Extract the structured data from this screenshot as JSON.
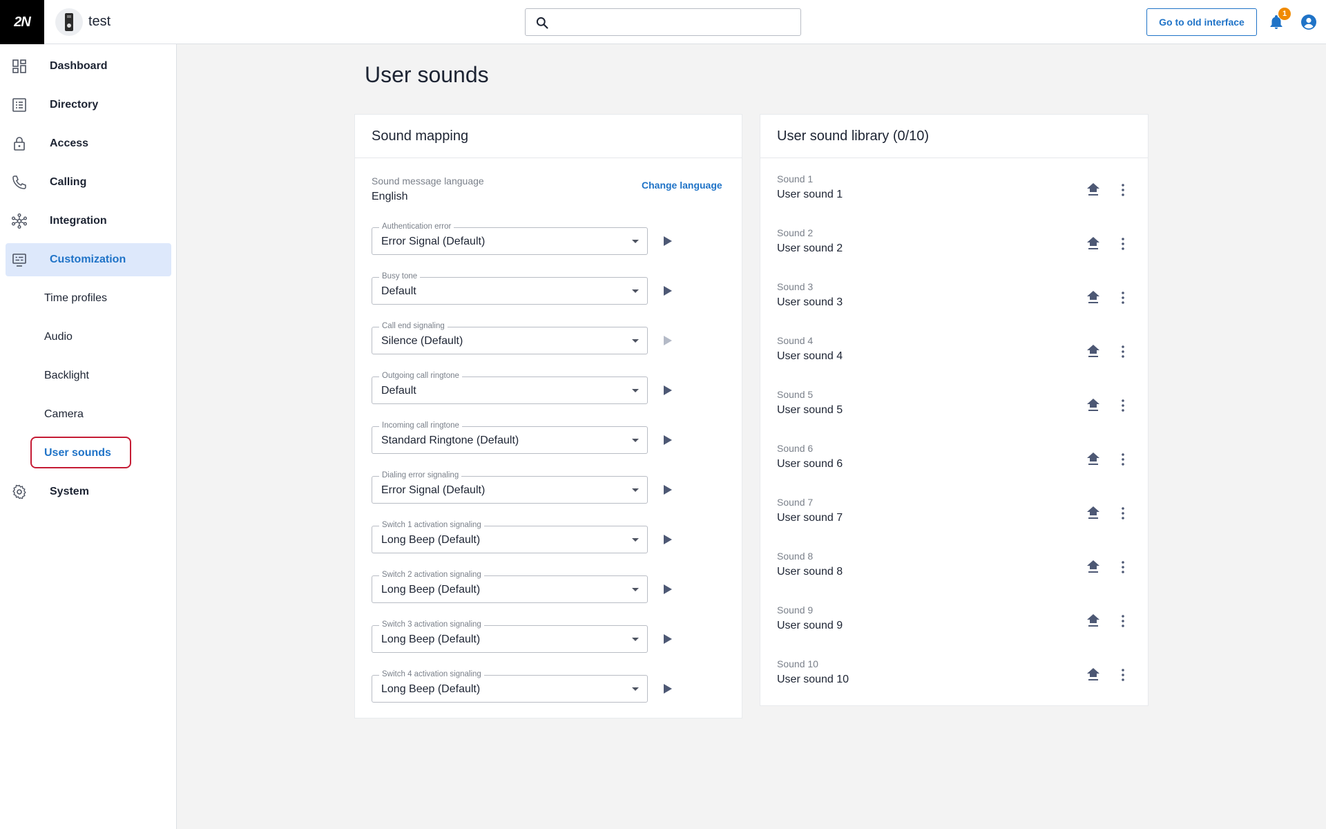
{
  "header": {
    "logo": "2N",
    "device_name": "test",
    "search_placeholder": "",
    "old_interface_label": "Go to old interface",
    "notification_count": "1"
  },
  "sidebar": {
    "items": [
      {
        "label": "Dashboard",
        "icon": "dashboard-icon"
      },
      {
        "label": "Directory",
        "icon": "directory-icon"
      },
      {
        "label": "Access",
        "icon": "lock-icon"
      },
      {
        "label": "Calling",
        "icon": "phone-icon"
      },
      {
        "label": "Integration",
        "icon": "integration-icon"
      },
      {
        "label": "Customization",
        "icon": "customization-icon"
      }
    ],
    "sub_items": [
      "Time profiles",
      "Audio",
      "Backlight",
      "Camera",
      "User sounds"
    ],
    "system": {
      "label": "System",
      "icon": "gear-icon"
    },
    "active": "User sounds"
  },
  "page": {
    "title": "User sounds"
  },
  "sound_mapping": {
    "title": "Sound mapping",
    "language_label": "Sound message language",
    "language_value": "English",
    "change_language": "Change language",
    "fields": [
      {
        "label": "Authentication error",
        "value": "Error Signal (Default)",
        "play_enabled": true
      },
      {
        "label": "Busy tone",
        "value": "Default",
        "play_enabled": true
      },
      {
        "label": "Call end signaling",
        "value": "Silence (Default)",
        "play_enabled": false
      },
      {
        "label": "Outgoing call ringtone",
        "value": "Default",
        "play_enabled": true
      },
      {
        "label": "Incoming call ringtone",
        "value": "Standard Ringtone (Default)",
        "play_enabled": true
      },
      {
        "label": "Dialing error signaling",
        "value": "Error Signal (Default)",
        "play_enabled": true
      },
      {
        "label": "Switch 1 activation signaling",
        "value": "Long Beep (Default)",
        "play_enabled": true
      },
      {
        "label": "Switch 2 activation signaling",
        "value": "Long Beep (Default)",
        "play_enabled": true
      },
      {
        "label": "Switch 3 activation signaling",
        "value": "Long Beep (Default)",
        "play_enabled": true
      },
      {
        "label": "Switch 4 activation signaling",
        "value": "Long Beep (Default)",
        "play_enabled": true
      }
    ]
  },
  "library": {
    "title": "User sound library (0/10)",
    "sounds": [
      {
        "name": "Sound 1",
        "value": "User sound 1"
      },
      {
        "name": "Sound 2",
        "value": "User sound 2"
      },
      {
        "name": "Sound 3",
        "value": "User sound 3"
      },
      {
        "name": "Sound 4",
        "value": "User sound 4"
      },
      {
        "name": "Sound 5",
        "value": "User sound 5"
      },
      {
        "name": "Sound 6",
        "value": "User sound 6"
      },
      {
        "name": "Sound 7",
        "value": "User sound 7"
      },
      {
        "name": "Sound 8",
        "value": "User sound 8"
      },
      {
        "name": "Sound 9",
        "value": "User sound 9"
      },
      {
        "name": "Sound 10",
        "value": "User sound 10"
      }
    ]
  },
  "colors": {
    "accent": "#1f73c7",
    "active_nav_bg": "#dde8fb",
    "highlight": "#c51b34",
    "badge": "#f08a00"
  }
}
